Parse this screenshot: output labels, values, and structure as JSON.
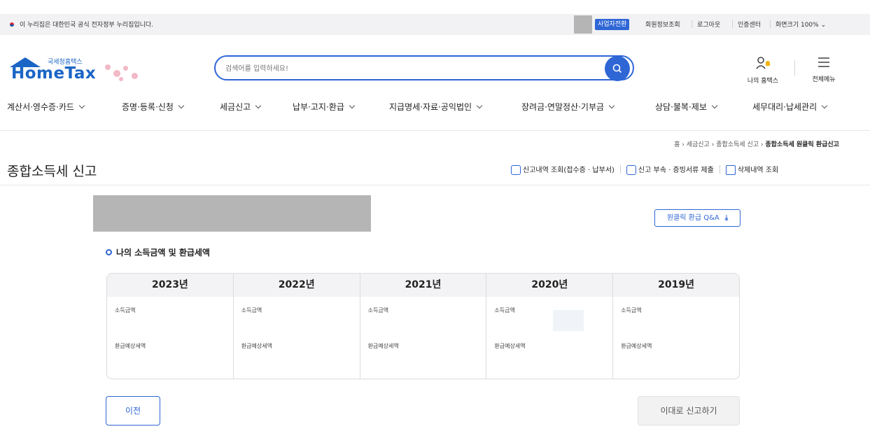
{
  "gov_banner": {
    "text": "이 누리집은 대한민국 공식 전자정부 누리집입니다."
  },
  "utility": {
    "business_switch": "사업자전환",
    "member_info": "회원정보조회",
    "logout": "로그아웃",
    "cert_center": "인증센터",
    "screen_size": "화면크기 100%"
  },
  "logo": {
    "sub": "국세청홈택스",
    "main": "HomeTax"
  },
  "search": {
    "placeholder": "검색어를 입력하세요!"
  },
  "header_links": {
    "my_hometax": "나의 홈택스",
    "all_menu": "전체메뉴"
  },
  "nav": [
    "계산서·영수증·카드",
    "증명·등록·신청",
    "세금신고",
    "납부·고지·환급",
    "지급명세·자료·공익법인",
    "장려금·연말정산·기부금",
    "상담·불복·제보",
    "세무대리·납세관리"
  ],
  "breadcrumb": {
    "home": "홈",
    "level1": "세금신고",
    "level2": "종합소득세 신고",
    "current": "종합소득세 원클릭 환급신고"
  },
  "page_title": "종합소득세 신고",
  "actions": {
    "history": "신고내역 조회(접수증 · 납부서)",
    "attach": "신고 부속 · 증빙서류 제출",
    "deleted": "삭제내역 조회"
  },
  "qa_button": "원클릭 환급 Q&A",
  "section_title": "나의 소득금액 및 환급세액",
  "years": [
    {
      "year": "2023년",
      "income_label": "소득금액",
      "refund_label": "환급예상세액"
    },
    {
      "year": "2022년",
      "income_label": "소득금액",
      "refund_label": "환급예상세액"
    },
    {
      "year": "2021년",
      "income_label": "소득금액",
      "refund_label": "환급예상세액"
    },
    {
      "year": "2020년",
      "income_label": "소득금액",
      "refund_label": "환급예상세액"
    },
    {
      "year": "2019년",
      "income_label": "소득금액",
      "refund_label": "환급예상세액"
    }
  ],
  "buttons": {
    "prev": "이전",
    "submit": "이대로 신고하기"
  },
  "colors": {
    "accent": "#2f66d6",
    "logo": "#1b65c6"
  }
}
